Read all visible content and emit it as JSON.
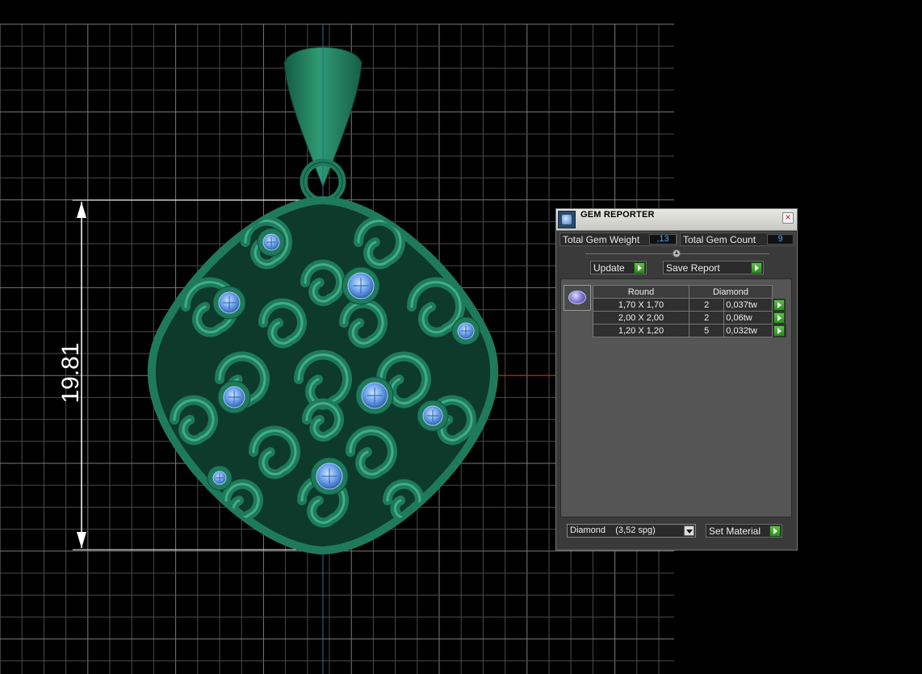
{
  "dimension": {
    "value": "19.81"
  },
  "gem_reporter": {
    "title": "GEM REPORTER",
    "close_label": "×",
    "total_weight": {
      "label": "Total Gem Weight",
      "value": ",13"
    },
    "total_count": {
      "label": "Total Gem Count",
      "value": "9"
    },
    "update_label": "Update",
    "save_label": "Save Report",
    "table": {
      "columns": [
        "Round",
        "Diamond"
      ],
      "rows": [
        {
          "size": "1,70 X 1,70",
          "count": "2",
          "weight": "0,037tw"
        },
        {
          "size": "2,00 X 2,00",
          "count": "2",
          "weight": "0,06tw"
        },
        {
          "size": "1,20 X 1,20",
          "count": "5",
          "weight": "0,032tw"
        }
      ]
    },
    "material_select": "Diamond    (3,52 spg)",
    "set_material_label": "Set Material"
  },
  "colors": {
    "metal": "#1f7a5c",
    "gem": "#6aa2ea",
    "grid": "#4a4a4a",
    "grid_major": "#7a7a7a"
  },
  "icons": [
    "gem-reporter-app-icon",
    "close-icon",
    "collapse-icon",
    "play-arrow-icon",
    "gem-thumbnail-icon",
    "dropdown-arrow-icon"
  ]
}
